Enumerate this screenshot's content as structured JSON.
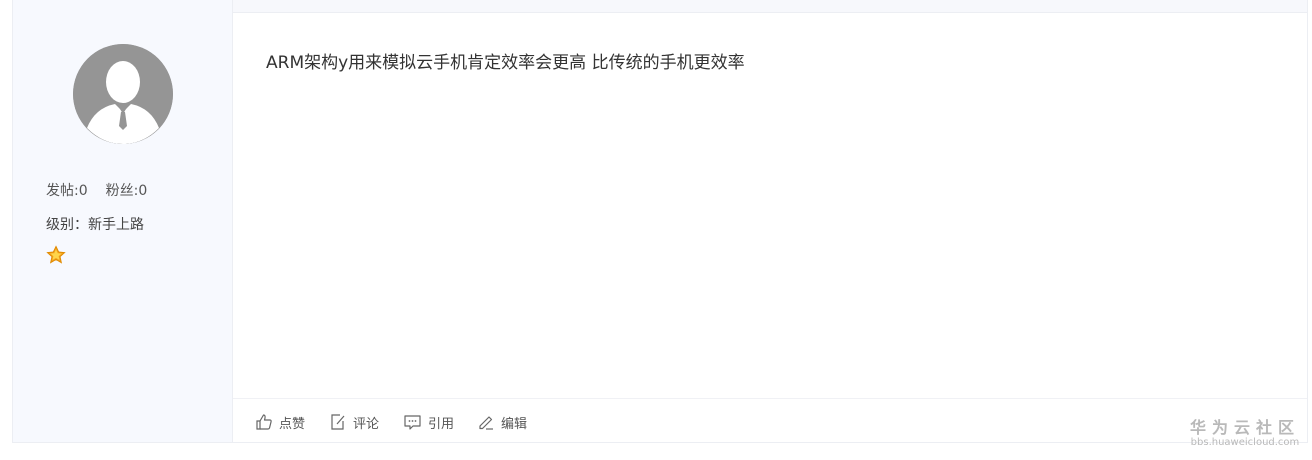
{
  "author": {
    "avatar_icon": "default-user-avatar-icon",
    "posts_label": "发帖:0",
    "fans_label": "粉丝:0",
    "level_label": "级别：新手上路",
    "medal_icon": "star-medal-icon"
  },
  "post": {
    "content": "ARM架构y用来模拟云手机肯定效率会更高 比传统的手机更效率"
  },
  "actions": {
    "like": {
      "label": "点赞",
      "icon": "thumbs-up-icon"
    },
    "comment": {
      "label": "评论",
      "icon": "edit-note-icon"
    },
    "quote": {
      "label": "引用",
      "icon": "speech-bubble-icon"
    },
    "edit": {
      "label": "编辑",
      "icon": "pencil-icon"
    }
  },
  "watermark": {
    "title": "华为云社区",
    "url": "bbs.huaweicloud.com"
  },
  "colors": {
    "sidebar_bg": "#f7f9fe",
    "avatar_gray": "#959595",
    "medal_orange": "#f5a623"
  }
}
